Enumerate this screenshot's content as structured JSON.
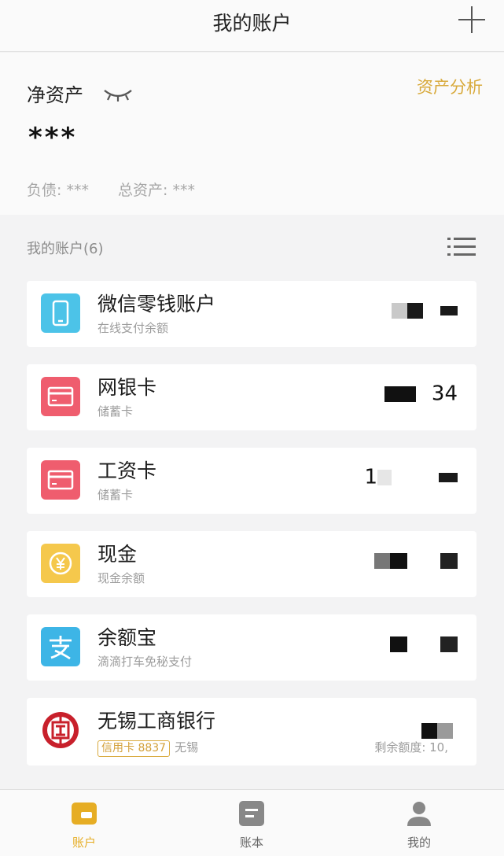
{
  "header": {
    "title": "我的账户"
  },
  "summary": {
    "net_label": "净资产",
    "net_value": "***",
    "analysis_link": "资产分析",
    "liabilities": "负债: ***",
    "total_assets": "总资产: ***"
  },
  "accounts_section": {
    "title": "我的账户(6)"
  },
  "accounts": [
    {
      "name": "微信零钱账户",
      "desc": "在线支付余额",
      "balance_visible": "",
      "icon": "phone-icon",
      "color": "#4cc3e8"
    },
    {
      "name": "网银卡",
      "desc": "储蓄卡",
      "balance_visible": "34",
      "icon": "card-icon",
      "color": "#ef5d6e"
    },
    {
      "name": "工资卡",
      "desc": "储蓄卡",
      "balance_visible": "1",
      "icon": "card-icon",
      "color": "#ef5d6e"
    },
    {
      "name": "现金",
      "desc": "现金余额",
      "balance_visible": "",
      "icon": "yuan-coin-icon",
      "color": "#f5c84c"
    },
    {
      "name": "余额宝",
      "desc": "滴滴打车免秘支付",
      "balance_visible": "",
      "icon": "alipay-icon",
      "color": "#3db5e6"
    },
    {
      "name": "无锡工商银行",
      "tag": "信用卡 8837",
      "location": "无锡",
      "remaining_label": "剩余额度: 10,",
      "icon": "icbc-logo-icon",
      "color": "#c8202b"
    }
  ],
  "tabbar": {
    "tabs": [
      {
        "label": "账户",
        "active": true
      },
      {
        "label": "账本",
        "active": false
      },
      {
        "label": "我的",
        "active": false
      }
    ],
    "active_color": "#e6ad24",
    "inactive_color": "#666666"
  }
}
